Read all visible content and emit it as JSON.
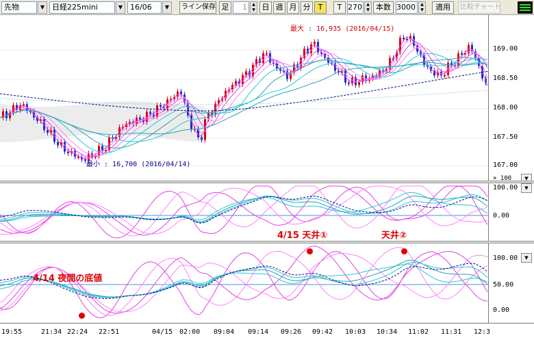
{
  "toolbar": {
    "symbol": "先物",
    "instrument": "日経225mini",
    "contract": "16/06",
    "save_lines": "ライン保存",
    "bar_label": "足",
    "bar_count": "1",
    "period_day": "日",
    "period_week": "週",
    "period_month": "月",
    "period_minute": "分",
    "tick_T_active": "T",
    "tick_T": "T",
    "tick_value": "270",
    "count_label": "本数",
    "count_value": "3000",
    "apply": "適用",
    "compare_chart": "比較チャート"
  },
  "price_axis": {
    "labels": [
      "169.00",
      "168.50",
      "168.00",
      "167.50",
      "167.00"
    ],
    "multiplier": "× 100"
  },
  "price_notes": {
    "max": "最大 : 16,935 (2016/04/15)",
    "min": "最小 : 16,700 (2016/04/14)"
  },
  "osc1_axis": [
    "100.00",
    "0.00"
  ],
  "osc2_axis": [
    "100.00",
    "50.00",
    "0.00"
  ],
  "notes": {
    "top1": "4/15 天井①",
    "top2": "天井②",
    "bottom": "4/14 夜間の底値"
  },
  "time_axis": [
    "19:55",
    "21:34",
    "22:24",
    "22:51",
    "04/15",
    "02:00",
    "09:04",
    "09:14",
    "09:26",
    "09:42",
    "10:03",
    "10:34",
    "11:02",
    "11:31",
    "12:3"
  ],
  "colors": {
    "up": "#e00000",
    "down": "#1a2fd0",
    "magenta": "#e040e0",
    "pink": "#ff80ff",
    "cyan": "#20c8d8",
    "teal": "#2fa0b0",
    "navy": "#000080",
    "annotation": "#e00000"
  }
}
